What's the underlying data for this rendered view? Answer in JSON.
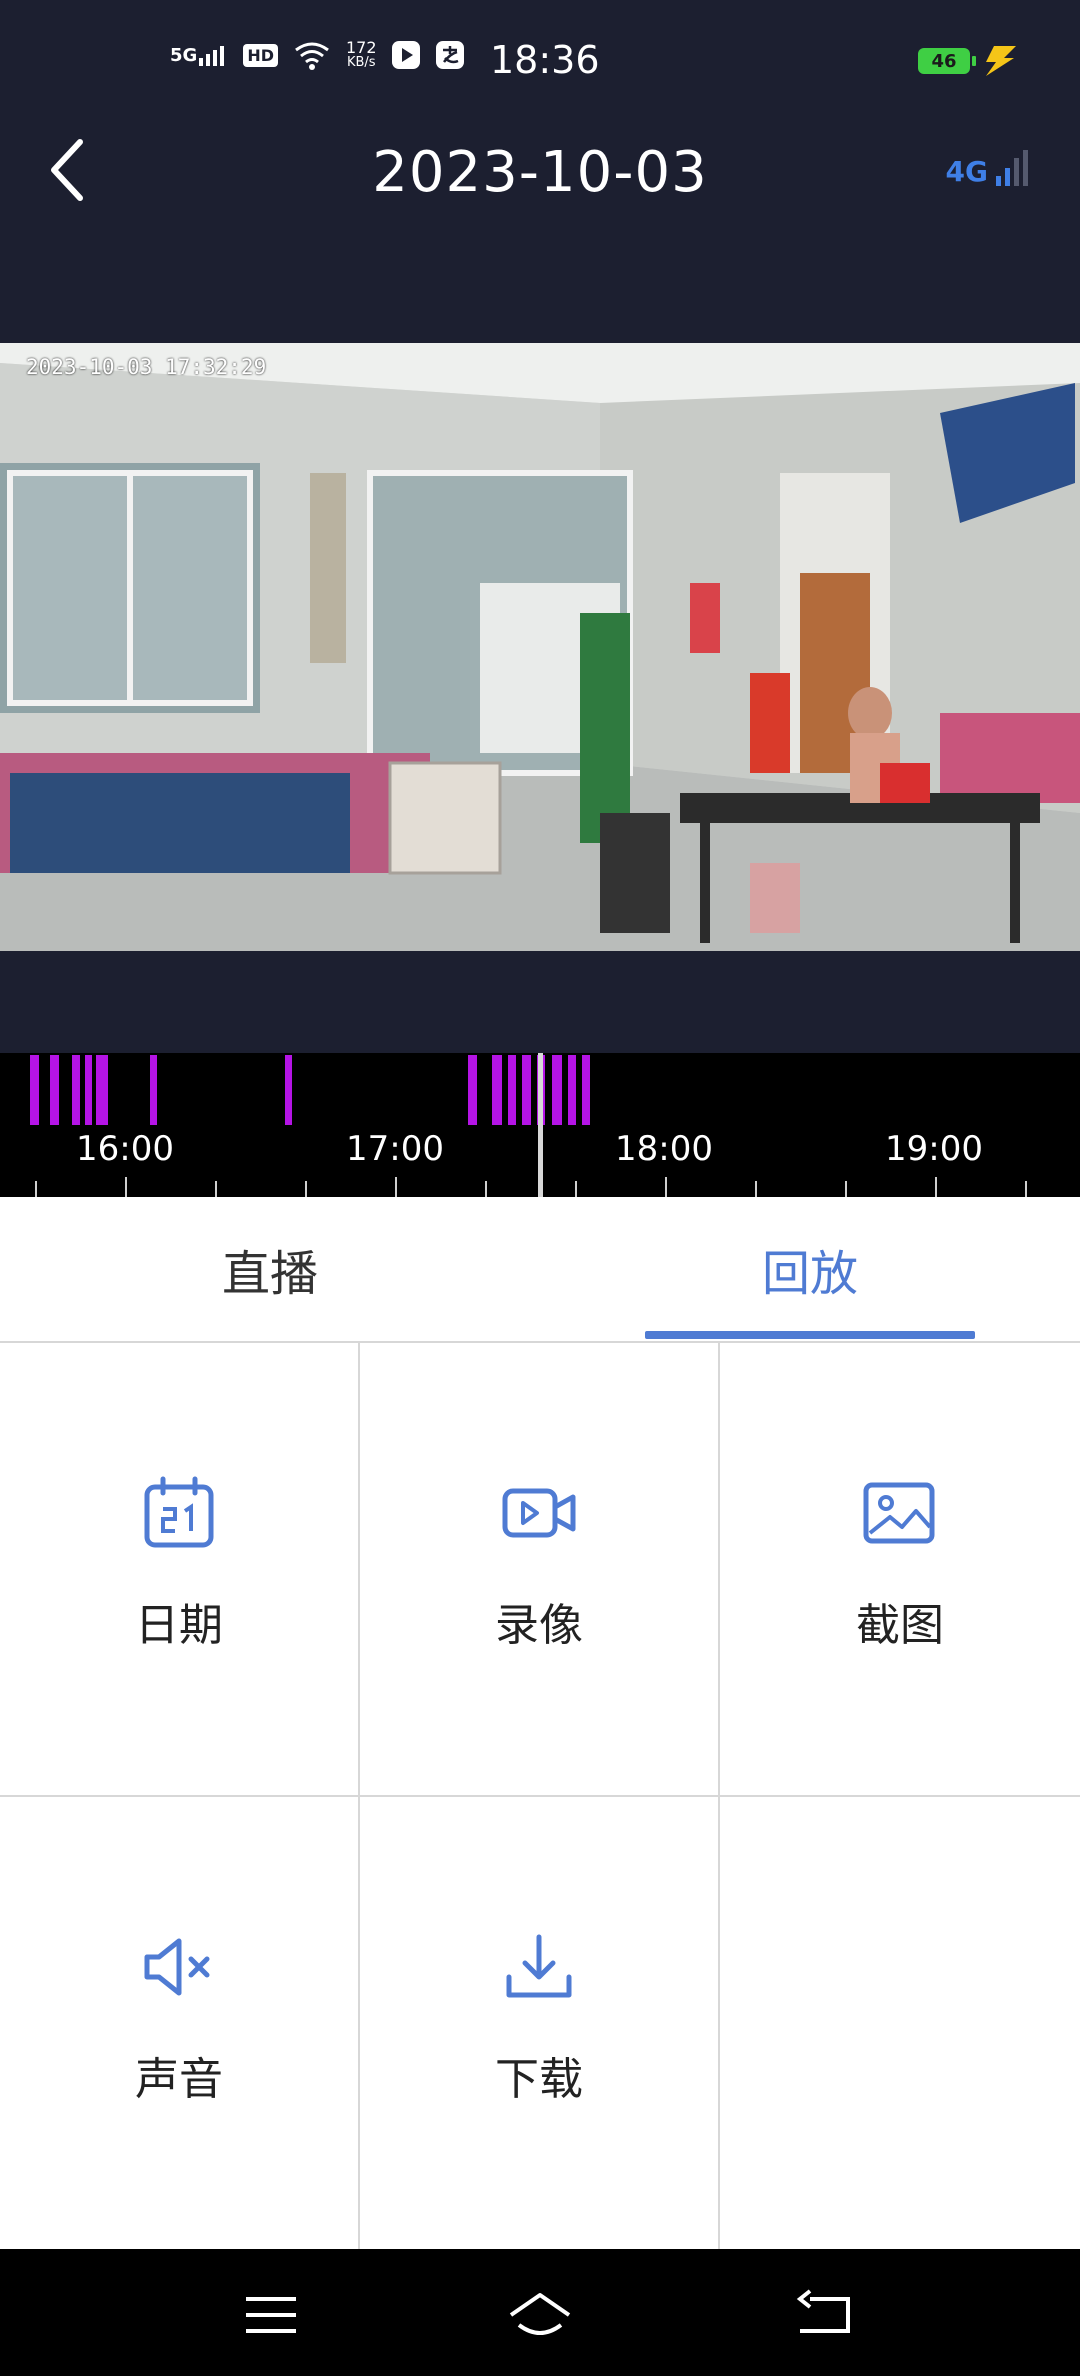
{
  "status_bar": {
    "network": "5G",
    "hd": "HD",
    "speed_value": "172",
    "speed_unit": "KB/s",
    "time": "18:36",
    "battery": "46"
  },
  "header": {
    "title": "2023-10-03",
    "signal_label": "4G"
  },
  "video": {
    "timestamp": "2023-10-03 17:32:29"
  },
  "timeline": {
    "labels": [
      "16:00",
      "17:00",
      "18:00",
      "19:00"
    ],
    "current_time": "17:32:29",
    "recording_color": "#b514e6"
  },
  "tabs": [
    {
      "label": "直播",
      "active": false
    },
    {
      "label": "回放",
      "active": true
    }
  ],
  "actions": [
    {
      "label": "日期",
      "icon": "calendar-icon"
    },
    {
      "label": "录像",
      "icon": "video-camera-icon"
    },
    {
      "label": "截图",
      "icon": "image-icon"
    },
    {
      "label": "声音",
      "icon": "speaker-muted-icon"
    },
    {
      "label": "下载",
      "icon": "download-icon"
    }
  ],
  "colors": {
    "accent": "#4f7bd3",
    "background": "#1c1f30"
  }
}
